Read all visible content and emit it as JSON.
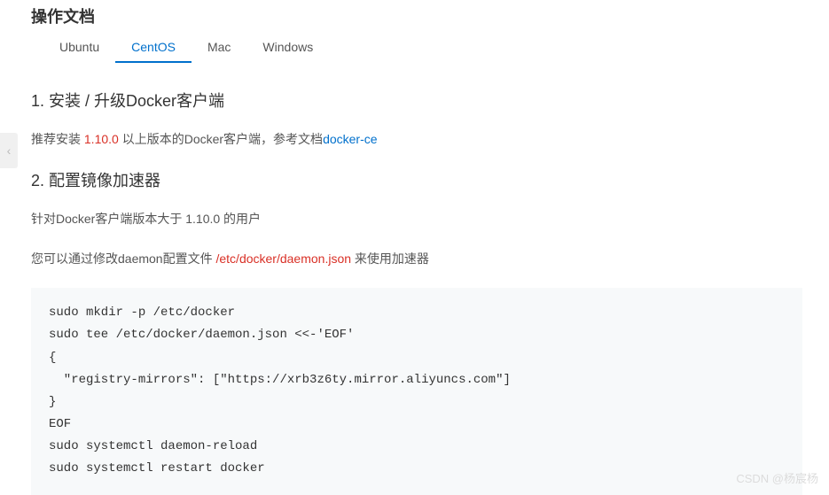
{
  "page_title": "操作文档",
  "tabs": {
    "ubuntu": "Ubuntu",
    "centos": "CentOS",
    "mac": "Mac",
    "windows": "Windows"
  },
  "section1": {
    "heading": "1. 安装 / 升级Docker客户端",
    "text_prefix": "推荐安装 ",
    "version": "1.10.0",
    "text_mid": " 以上版本的Docker客户端，参考文档",
    "link": "docker-ce"
  },
  "section2": {
    "heading": "2. 配置镜像加速器",
    "line1": "针对Docker客户端版本大于 1.10.0 的用户",
    "line2_prefix": "您可以通过修改daemon配置文件 ",
    "filepath": "/etc/docker/daemon.json",
    "line2_suffix": " 来使用加速器"
  },
  "code": "sudo mkdir -p /etc/docker\nsudo tee /etc/docker/daemon.json <<-'EOF'\n{\n  \"registry-mirrors\": [\"https://xrb3z6ty.mirror.aliyuncs.com\"]\n}\nEOF\nsudo systemctl daemon-reload\nsudo systemctl restart docker",
  "side_handle": "‹",
  "watermark": "CSDN @杨宸杨"
}
